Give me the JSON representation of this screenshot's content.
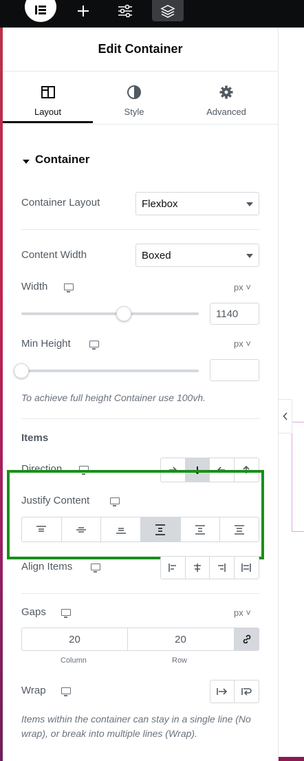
{
  "topbar": {
    "icons": [
      "elementor-logo-icon",
      "plus-icon",
      "sliders-icon",
      "layers-icon"
    ]
  },
  "panel": {
    "title": "Edit Container"
  },
  "tabs": [
    {
      "label": "Layout",
      "icon": "layout-icon"
    },
    {
      "label": "Style",
      "icon": "contrast-icon"
    },
    {
      "label": "Advanced",
      "icon": "gear-icon"
    }
  ],
  "section": {
    "title": "Container"
  },
  "container_layout": {
    "label": "Container Layout",
    "value": "Flexbox"
  },
  "content_width": {
    "label": "Content Width",
    "value": "Boxed"
  },
  "width": {
    "label": "Width",
    "unit": "px",
    "value": "1140"
  },
  "min_height": {
    "label": "Min Height",
    "unit": "px",
    "value": ""
  },
  "min_height_note": "To achieve full height Container use 100vh.",
  "items": {
    "title": "Items"
  },
  "direction": {
    "label": "Direction",
    "selected_index": 1
  },
  "justify": {
    "label": "Justify Content",
    "selected_index": 3
  },
  "align": {
    "label": "Align Items"
  },
  "gaps": {
    "label": "Gaps",
    "unit": "px",
    "column": "20",
    "row": "20",
    "column_label": "Column",
    "row_label": "Row"
  },
  "wrap": {
    "label": "Wrap",
    "note": "Items within the container can stay in a single line (No wrap), or break into multiple lines (Wrap)."
  },
  "colors": {
    "highlight": "#1a8f1a",
    "active": "#0c0d0e",
    "text": "#515962"
  }
}
